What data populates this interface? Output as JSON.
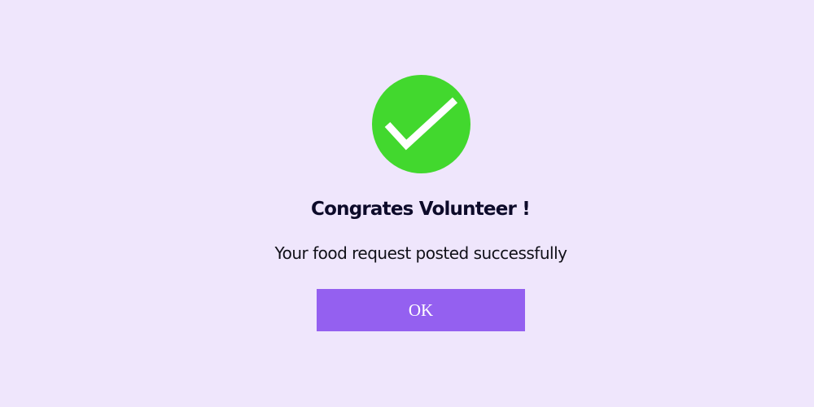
{
  "dialog": {
    "icon": "check-circle-icon",
    "title": "Congrates Volunteer !",
    "message": "Your food request posted successfully",
    "ok_label": "OK"
  },
  "colors": {
    "background": "#efe6fc",
    "success_green": "#42d82e",
    "button_purple": "#9460f0",
    "title_text": "#0d0b2a"
  }
}
